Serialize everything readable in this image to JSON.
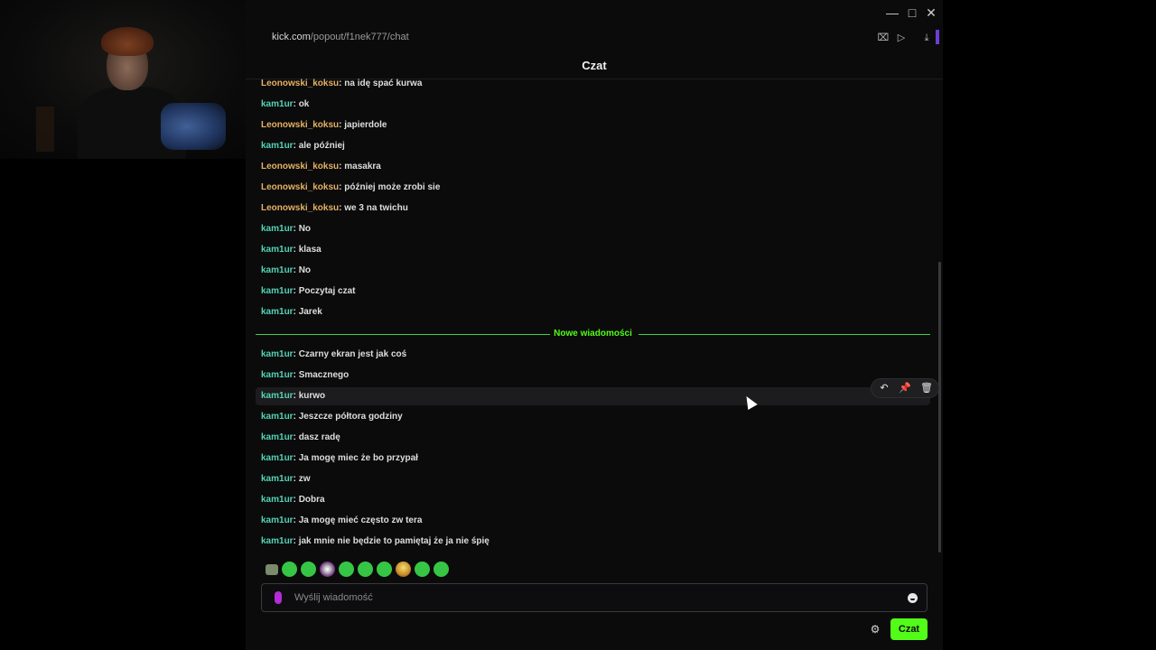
{
  "window": {
    "minimize_icon": "minimize-icon",
    "maximize_icon": "maximize-icon",
    "close_icon": "close-icon"
  },
  "address_bar": {
    "domain": "kick.com",
    "path": "/popout/f1nek777/chat"
  },
  "toolbar": {
    "icons": [
      "shield-close-icon",
      "play-icon",
      "download-icon"
    ]
  },
  "header": {
    "title": "Czat"
  },
  "colors": {
    "accent": "#53fc18",
    "leonowski": "#e5b163",
    "kamiur": "#54d3b6",
    "background": "#0b0b0c"
  },
  "messages_before": [
    {
      "user": "Leonowski_koksu",
      "text": "na idę spać kurwa"
    },
    {
      "user": "kam1ur",
      "text": "ok"
    },
    {
      "user": "Leonowski_koksu",
      "text": "japierdole"
    },
    {
      "user": "kam1ur",
      "text": "ale później"
    },
    {
      "user": "Leonowski_koksu",
      "text": "masakra"
    },
    {
      "user": "Leonowski_koksu",
      "text": "później może zrobi sie"
    },
    {
      "user": "Leonowski_koksu",
      "text": "we 3 na twichu"
    },
    {
      "user": "kam1ur",
      "text": "No"
    },
    {
      "user": "kam1ur",
      "text": "klasa"
    },
    {
      "user": "kam1ur",
      "text": "No"
    },
    {
      "user": "kam1ur",
      "text": "Poczytaj czat"
    },
    {
      "user": "kam1ur",
      "text": "Jarek"
    }
  ],
  "divider": {
    "label": "Nowe wiadomości"
  },
  "messages_after": [
    {
      "user": "kam1ur",
      "text": "Czarny ekran jest jak coś"
    },
    {
      "user": "kam1ur",
      "text": "Smacznego"
    },
    {
      "user": "kam1ur",
      "text": "kurwo"
    },
    {
      "user": "kam1ur",
      "text": "Jeszcze półtora godziny"
    },
    {
      "user": "kam1ur",
      "text": "dasz radę"
    },
    {
      "user": "kam1ur",
      "text": "Ja mogę miec że bo przypał"
    },
    {
      "user": "kam1ur",
      "text": "zw"
    },
    {
      "user": "kam1ur",
      "text": "Dobra"
    },
    {
      "user": "kam1ur",
      "text": "Ja mogę mieć często zw tera"
    },
    {
      "user": "kam1ur",
      "text": "jak mnie nie będzie to pamiętaj że ja nie śpię"
    }
  ],
  "message_tools": [
    "reply-icon",
    "pin-icon",
    "delete-icon"
  ],
  "emotes": [
    "emote-1",
    "emote-2",
    "emote-3",
    "emote-4",
    "emote-5",
    "emote-6",
    "emote-7",
    "emote-8",
    "emote-9",
    "emote-10"
  ],
  "chat_input": {
    "placeholder": "Wyślij wiadomość"
  },
  "send_button": {
    "label": "Czat"
  }
}
